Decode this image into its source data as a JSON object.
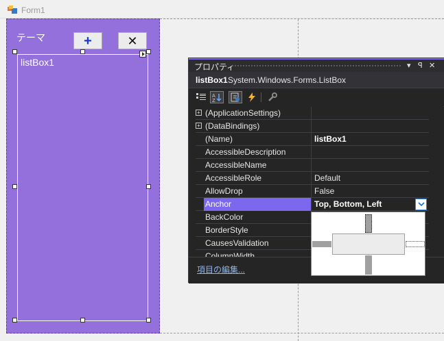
{
  "form": {
    "title": "Form1"
  },
  "panel": {
    "label": "テーマ",
    "add_button": "+",
    "delete_button": "✕",
    "listbox_text": "listBox1"
  },
  "properties": {
    "title": "プロパティ",
    "pin": "▾",
    "pin2": "ꟼ",
    "close": "✕",
    "object_name": "listBox1",
    "object_type": "System.Windows.Forms.ListBox",
    "rows": [
      {
        "name": "(ApplicationSettings)",
        "value": "",
        "expander": "+"
      },
      {
        "name": "(DataBindings)",
        "value": "",
        "expander": "+"
      },
      {
        "name": "(Name)",
        "value": "listBox1",
        "bold": true
      },
      {
        "name": "AccessibleDescription",
        "value": ""
      },
      {
        "name": "AccessibleName",
        "value": ""
      },
      {
        "name": "AccessibleRole",
        "value": "Default"
      },
      {
        "name": "AllowDrop",
        "value": "False"
      },
      {
        "name": "Anchor",
        "value": "Top, Bottom, Left",
        "selected": true
      },
      {
        "name": "BackColor",
        "value": ""
      },
      {
        "name": "BorderStyle",
        "value": ""
      },
      {
        "name": "CausesValidation",
        "value": ""
      },
      {
        "name": "ColumnWidth",
        "value": ""
      }
    ],
    "edit_items_link": "項目の編集..."
  },
  "colors": {
    "panel_bg": "#9370db",
    "accent": "#7b68ee",
    "props_bg": "#252526"
  },
  "icons": [
    "categorized-icon",
    "alphabetical-icon",
    "properties-icon",
    "events-icon",
    "property-pages-icon"
  ]
}
